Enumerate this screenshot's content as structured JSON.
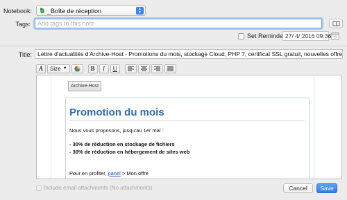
{
  "notebook": {
    "label": "Notebook:",
    "value": "_Boîte de réception"
  },
  "tags": {
    "label": "Tags:",
    "placeholder": "Add tags to this note"
  },
  "reminder": {
    "label": "Set Reminder:",
    "value": "27/ 4/ 2016 09:36"
  },
  "title": {
    "label": "Title:",
    "value": "Lettre d'actualités d'Archive-Host - Promotions du mois, stockage Cloud, PHP 7, certificat SSL gratuit, nouvelles offres"
  },
  "toolbar": {
    "font_label": "A",
    "size_label": "Size",
    "bold_label": "B",
    "italic_label": "I",
    "underline_label": "U"
  },
  "email": {
    "button_label": "Archive-Host",
    "heading": "Promotion du mois",
    "intro": "Nous vous proposons, jusqu'au 1er mai :",
    "offer1": "- 30% de réduction en stockage de fichiers",
    "offer2": "- 30% de réduction en hébergement de sites web",
    "profit_prefix": "Pour en profiter, ",
    "profit_link": "panel",
    "profit_suffix": " > Mon offre"
  },
  "attach": {
    "label": "Include email attachments (No attachments)"
  },
  "buttons": {
    "cancel": "Cancel",
    "save": "Save"
  },
  "colors": {
    "accent": "#2f7ef2",
    "heading_blue": "#2f6db3",
    "evernote_green": "#4caf50"
  }
}
